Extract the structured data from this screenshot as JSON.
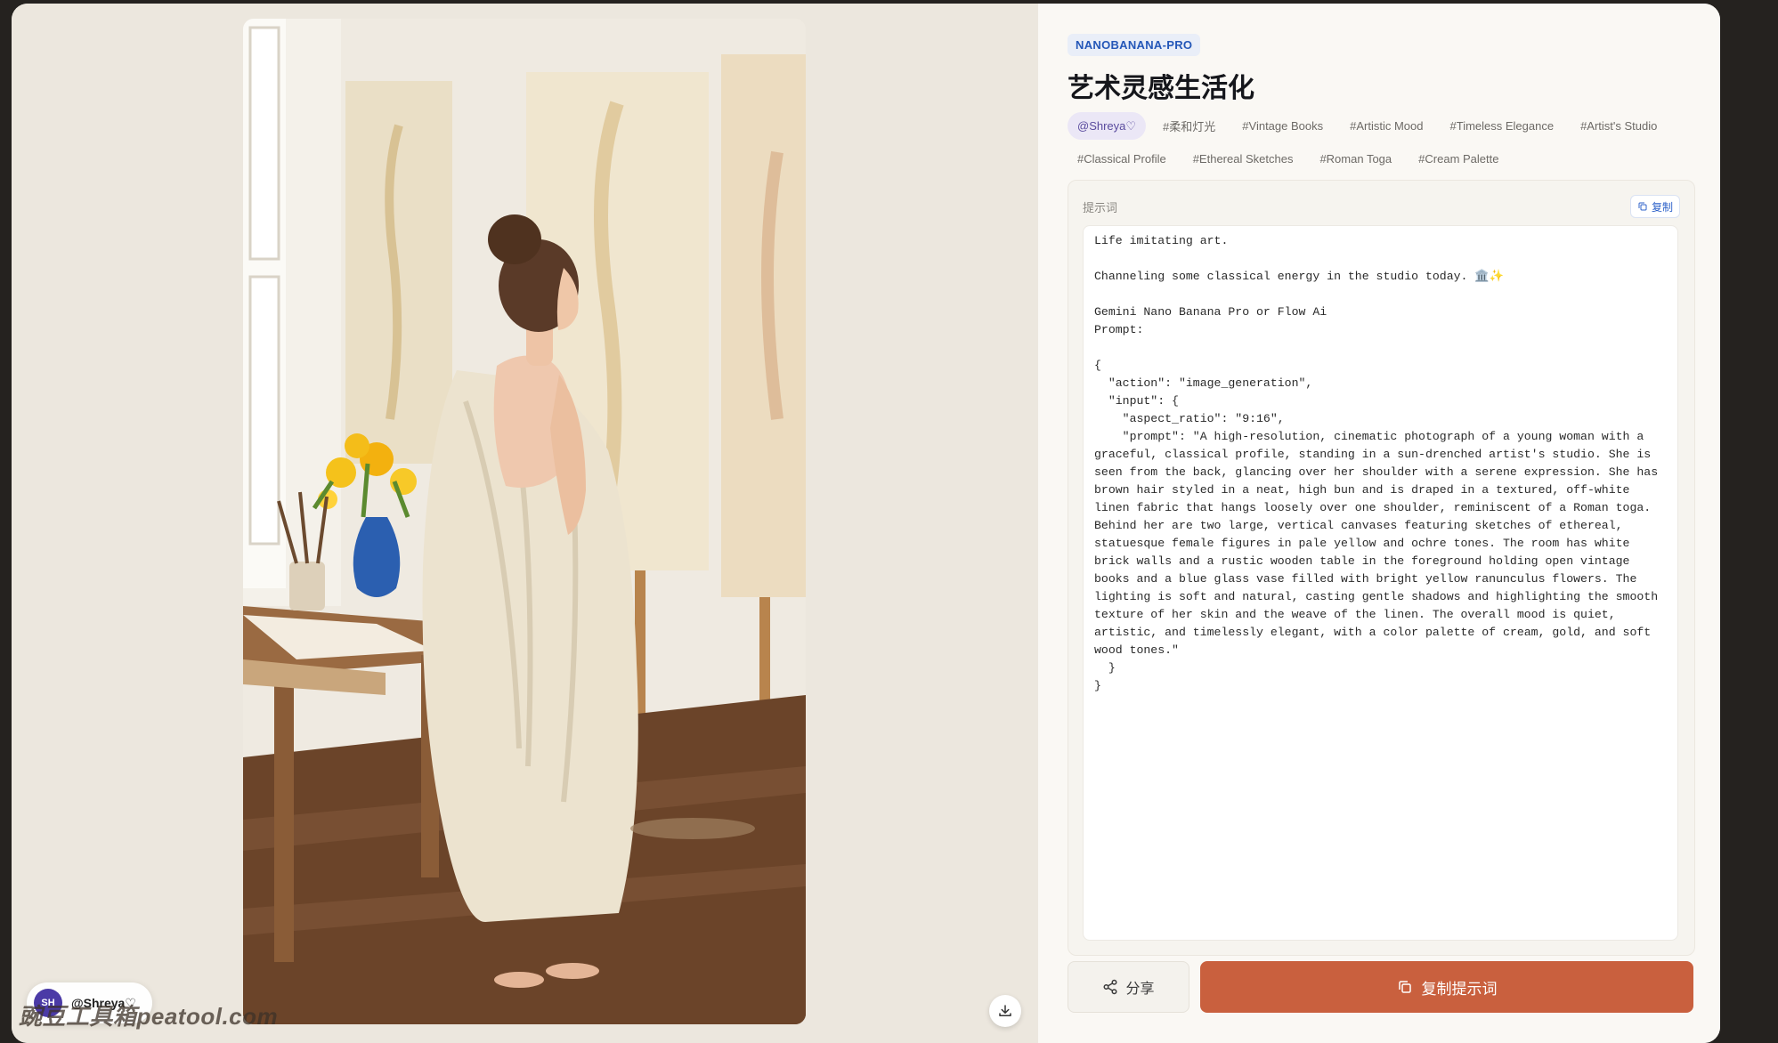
{
  "author": {
    "avatar_initials": "SH",
    "name": "@Shreya♡"
  },
  "watermark": "豌豆工具箱peatool.com",
  "icons": {
    "download": "download-icon",
    "share": "share-icon",
    "copy": "copy-icon"
  },
  "details": {
    "model_badge": "NANOBANANA-PRO",
    "title": "艺术灵感生活化",
    "tags": [
      "@Shreya♡",
      "#柔和灯光",
      "#Vintage Books",
      "#Artistic Mood",
      "#Timeless Elegance",
      "#Artist's Studio",
      "#Classical Profile",
      "#Ethereal Sketches",
      "#Roman Toga",
      "#Cream Palette"
    ],
    "prompt_label": "提示词",
    "copy_small_label": "复制",
    "prompt_text": "Life imitating art.\n\nChanneling some classical energy in the studio today. 🏛️✨\n\nGemini Nano Banana Pro or Flow Ai\nPrompt:\n\n{\n  \"action\": \"image_generation\",\n  \"input\": {\n    \"aspect_ratio\": \"9:16\",\n    \"prompt\": \"A high-resolution, cinematic photograph of a young woman with a graceful, classical profile, standing in a sun-drenched artist's studio. She is seen from the back, glancing over her shoulder with a serene expression. She has brown hair styled in a neat, high bun and is draped in a textured, off-white linen fabric that hangs loosely over one shoulder, reminiscent of a Roman toga. Behind her are two large, vertical canvases featuring sketches of ethereal, statuesque female figures in pale yellow and ochre tones. The room has white brick walls and a rustic wooden table in the foreground holding open vintage books and a blue glass vase filled with bright yellow ranunculus flowers. The lighting is soft and natural, casting gentle shadows and highlighting the smooth texture of her skin and the weave of the linen. The overall mood is quiet, artistic, and timelessly elegant, with a color palette of cream, gold, and soft wood tones.\"\n  }\n}"
  },
  "actions": {
    "share_label": "分享",
    "copy_prompt_label": "复制提示词"
  },
  "colors": {
    "accent": "#c9603e",
    "badge_text": "#2457b8",
    "author_tag_bg": "#ebe7f6"
  }
}
